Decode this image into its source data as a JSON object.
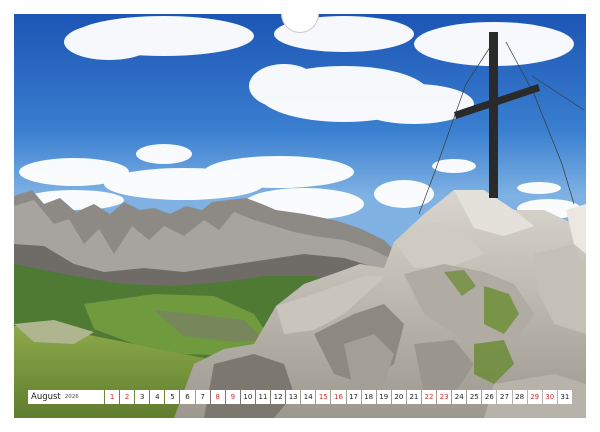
{
  "calendar": {
    "month": "August",
    "year": "2026",
    "days": [
      {
        "n": "1",
        "weekend": true
      },
      {
        "n": "2",
        "weekend": true
      },
      {
        "n": "3",
        "weekend": false
      },
      {
        "n": "4",
        "weekend": false
      },
      {
        "n": "5",
        "weekend": false
      },
      {
        "n": "6",
        "weekend": false
      },
      {
        "n": "7",
        "weekend": false
      },
      {
        "n": "8",
        "weekend": true
      },
      {
        "n": "9",
        "weekend": true
      },
      {
        "n": "10",
        "weekend": false
      },
      {
        "n": "11",
        "weekend": false
      },
      {
        "n": "12",
        "weekend": false
      },
      {
        "n": "13",
        "weekend": false
      },
      {
        "n": "14",
        "weekend": false
      },
      {
        "n": "15",
        "weekend": true
      },
      {
        "n": "16",
        "weekend": true
      },
      {
        "n": "17",
        "weekend": false
      },
      {
        "n": "18",
        "weekend": false
      },
      {
        "n": "19",
        "weekend": false
      },
      {
        "n": "20",
        "weekend": false
      },
      {
        "n": "21",
        "weekend": false
      },
      {
        "n": "22",
        "weekend": true
      },
      {
        "n": "23",
        "weekend": true
      },
      {
        "n": "24",
        "weekend": false
      },
      {
        "n": "25",
        "weekend": false
      },
      {
        "n": "26",
        "weekend": false
      },
      {
        "n": "27",
        "weekend": false
      },
      {
        "n": "28",
        "weekend": false
      },
      {
        "n": "29",
        "weekend": true
      },
      {
        "n": "30",
        "weekend": true
      },
      {
        "n": "31",
        "weekend": false
      }
    ]
  },
  "colors": {
    "weekend": "#d42a2a",
    "weekday": "#222222",
    "sky": "#2f6fc4"
  }
}
